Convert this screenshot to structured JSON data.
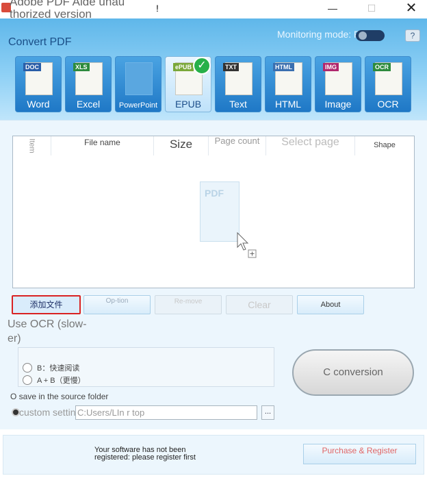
{
  "window": {
    "title": "Adobe PDF Aide unauthorized version",
    "title_line1": "Adobe PDF Aide unau",
    "title_line2": "thorized version",
    "title_suffix": "!",
    "minimize": "—",
    "maximize": "☐",
    "close": "✕"
  },
  "header": {
    "section_title": "Convert PDF",
    "monitoring_label": "Monitoring mode: PO",
    "help": "?",
    "tabs": [
      {
        "badge": "DOC",
        "label": "Word",
        "badge_color": "#2a5ea8"
      },
      {
        "badge": "XLS",
        "label": "Excel",
        "badge_color": "#2e8b3e"
      },
      {
        "badge": "",
        "label": "PowerPoint",
        "badge_color": "#d2691e"
      },
      {
        "badge": "ePUB",
        "label": "EPUB",
        "badge_color": "#7aa83a",
        "active": true
      },
      {
        "badge": "TXT",
        "label": "Text",
        "badge_color": "#333333"
      },
      {
        "badge": "HTML",
        "label": "HTML",
        "badge_color": "#3a6fb0"
      },
      {
        "badge": "IMG",
        "label": "Image",
        "badge_color": "#b0286e"
      },
      {
        "badge": "OCR",
        "label": "OCR",
        "badge_color": "#2e8b3e"
      }
    ],
    "tab_label_ppt_display": "PowerPoint",
    "check_mark": "✓"
  },
  "filelist": {
    "columns": {
      "item": "Item",
      "file_name": "File name",
      "size": "Size",
      "page_count": "Page count",
      "select_page": "Select page",
      "shape": "Shape"
    },
    "placeholder_icon_text": "PDF"
  },
  "actions": {
    "add_file": "添加文件",
    "option": "Op-tion",
    "remove": "Re-move",
    "clear": "Clear",
    "about": "About"
  },
  "ocr": {
    "label": "Use OCR (slow-er)",
    "option_b": "B：快速阅读",
    "option_ab": "A + B（更慢）"
  },
  "conversion": {
    "button": "C conversion"
  },
  "output": {
    "save_source": "O save in the source folder",
    "custom_label": "custom settings",
    "custom_path": "C:Users/LIn r top",
    "browse": "..."
  },
  "footer": {
    "register_text": "Your software has not been registered: please register first",
    "purchase": "Purchase & Register"
  },
  "colors": {
    "header_top": "#5fb7ea",
    "tab_blue": "#1f78c6",
    "accent_red": "#d92222",
    "check_green": "#27b04a"
  }
}
